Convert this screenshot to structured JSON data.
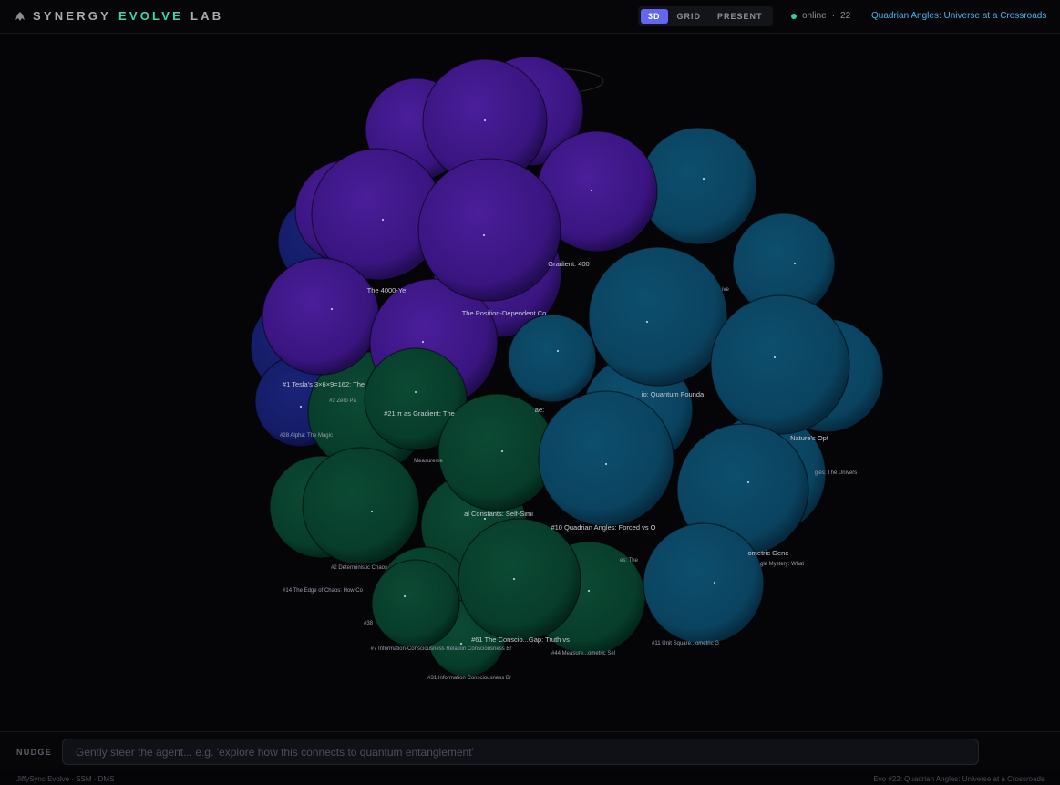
{
  "header": {
    "brand": [
      "SYNERGY",
      "EVOLVE",
      "LAB"
    ],
    "modes": [
      "3D",
      "GRID",
      "PRESENT"
    ],
    "active_mode": "3D",
    "status": "online",
    "separator": "·",
    "count": "22",
    "breadcrumb": "Quadrian Angles: Universe at a Crossroads"
  },
  "graph": {
    "colors": {
      "purple": "#4c1d95",
      "teal": "#0c5576",
      "green": "#064e35",
      "navy": "#1e2a86"
    },
    "labels": [
      "The 4000-Ye",
      "Gradient: 400",
      "The Position-Dependent Co",
      "#1 Tesla's 3×6×9=162: The",
      "#2 Zero Pa",
      "#28 Alpha: The Magic",
      "#21 π as Gradient: The",
      "Measureme",
      "ive",
      "ae:",
      "io: Quantum Founda",
      "Nature's Opt",
      "gles: The Univers",
      "al Constants: Self-Simi",
      "#10 Quadrian Angles: Forced vs O",
      "ometric Gene",
      "#2 Deterministic Chaos",
      "#14 The Edge of Chaos: How Co",
      "es: The",
      "gle Mystery: What",
      "#38",
      "#61 The Conscio...Gap: Truth vs",
      "#7 Information-Consciousness Relation Consciousness Br",
      "#44 Measure...ometric Sel",
      "#11 Unit Square...ometric G",
      "#31 Information Consciousness Br"
    ]
  },
  "nudge": {
    "label": "NUDGE",
    "placeholder": "Gently steer the agent... e.g. 'explore how this connects to quantum entanglement'"
  },
  "footer": {
    "left": "JiffySync Evolve · SSM · DMS",
    "right": "Evo #22: Quadrian Angles: Universe at a Crossroads"
  }
}
